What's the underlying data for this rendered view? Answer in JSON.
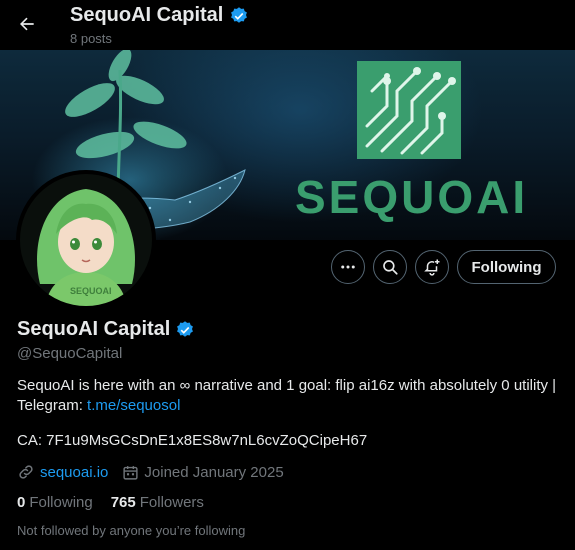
{
  "header": {
    "title": "SequoAI Capital",
    "posts_count": "8 posts",
    "back_icon": "arrow-left-icon"
  },
  "banner": {
    "brand_word": "SEQUOAI",
    "logo_color": "#3a9e6e"
  },
  "actions": {
    "more_icon": "more-icon",
    "search_icon": "search-icon",
    "notify_icon": "bell-plus-icon",
    "follow_label": "Following"
  },
  "profile": {
    "display_name": "SequoAI Capital",
    "verified": true,
    "handle": "@SequoCapital",
    "bio_text": "SequoAI is here with an ∞ narrative and 1 goal: flip ai16z with absolutely 0 utility | Telegram: ",
    "bio_link": "t.me/sequosol",
    "ca_line": "CA: 7F1u9MsGCsDnE1x8ES8w7nL6cvZoQCipeH67",
    "website": "sequoai.io",
    "joined": "Joined January 2025",
    "following_count": "0",
    "following_label": "Following",
    "followers_count": "765",
    "followers_label": "Followers",
    "followed_note": "Not followed by anyone you’re following"
  },
  "colors": {
    "accent": "#1d9bf0",
    "verified_badge": "#1d9bf0",
    "brand_green": "#3a9e6e"
  }
}
